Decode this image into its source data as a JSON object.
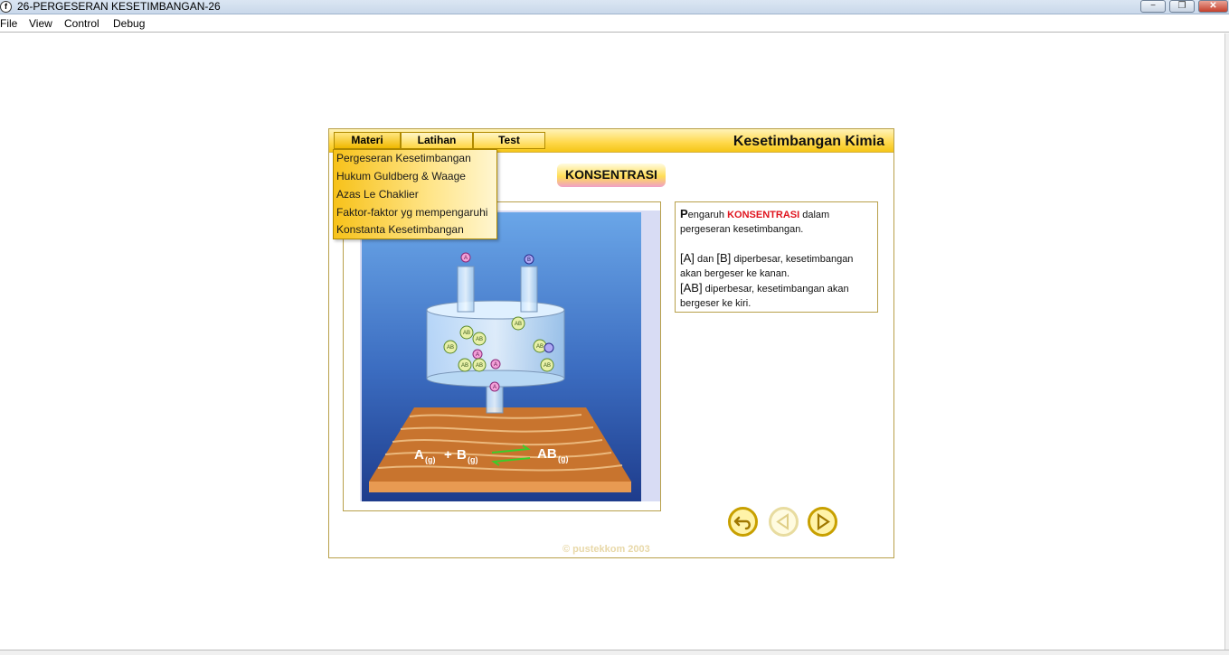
{
  "window": {
    "title": "26-PERGESERAN KESETIMBANGAN-26",
    "icon_glyph": "f",
    "controls": {
      "minimize": "−",
      "maximize": "❐",
      "close": "✕"
    }
  },
  "menubar": {
    "items": [
      "File",
      "View",
      "Control",
      "Debug"
    ]
  },
  "app": {
    "title": "Kesetimbangan Kimia",
    "tabs": [
      "Materi",
      "Latihan",
      "Test"
    ],
    "dropdown": [
      "Pergeseran Kesetimbangan",
      "Hukum Guldberg & Waage",
      "Azas Le Chaklier",
      "Faktor-faktor  yg mempengaruhi",
      "Konstanta Kesetimbangan"
    ],
    "section_badge": "KONSENTRASI",
    "text": {
      "line1_lead": "P",
      "line1_rest": "engaruh ",
      "line1_red": "KONSENTRASI",
      "line1_tail": " dalam pergeseran kesetimbangan.",
      "para2_a": "[A]",
      "para2_b": " dan ",
      "para2_c": "[B]",
      "para2_d": " diperbesar, kesetimbangan akan bergeser ke kanan.",
      "para3_a": "[AB]",
      "para3_b": " diperbesar, kesetimbangan akan bergeser ke kiri."
    },
    "equation": {
      "a": "A",
      "a_sub": "(g)",
      "plus": "+",
      "b": "B",
      "b_sub": "(g)",
      "ab": "AB",
      "ab_sub": "(g)"
    },
    "particle_labels": {
      "a": "A",
      "b": "B",
      "ab": "AB"
    },
    "icons": {
      "back": "return-arrow-icon",
      "prev": "triangle-left-icon",
      "next": "triangle-right-icon"
    },
    "copyright": "© pustekkom 2003",
    "colors": {
      "header": "#ffd84a",
      "accent_red": "#e0141e",
      "border": "#b8a04a",
      "nav_ring": "#c8a000"
    }
  }
}
